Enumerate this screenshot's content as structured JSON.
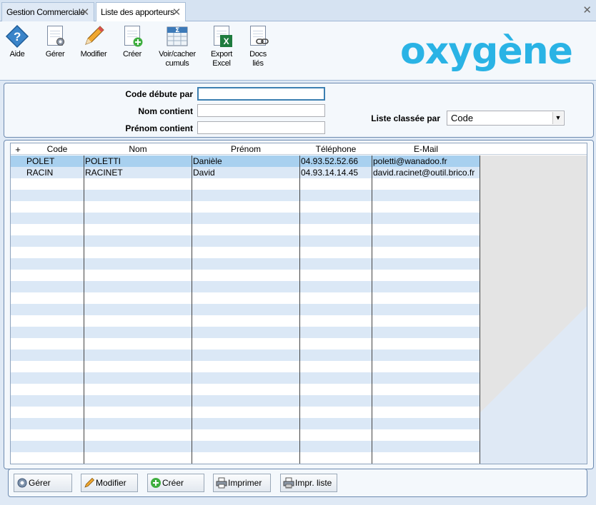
{
  "tabs": [
    {
      "label": "Gestion Commerciale",
      "active": false
    },
    {
      "label": "Liste des apporteurs",
      "active": true
    }
  ],
  "toolbar": {
    "items": [
      {
        "label": "Aide",
        "icon": "help-diamond-icon"
      },
      {
        "label": "Gérer",
        "icon": "document-gear-icon"
      },
      {
        "label": "Modifier",
        "icon": "pencil-icon"
      },
      {
        "label": "Créer",
        "icon": "document-add-icon"
      },
      {
        "label": "Voir/cacher\ncumuls",
        "icon": "sigma-icon"
      },
      {
        "label": "Export\nExcel",
        "icon": "excel-export-icon"
      },
      {
        "label": "Docs\nliés",
        "icon": "linked-docs-icon"
      }
    ],
    "logo": "oxygène"
  },
  "filter": {
    "code_label": "Code débute par",
    "code_value": "",
    "nom_label": "Nom contient",
    "nom_value": "",
    "prenom_label": "Prénom contient",
    "prenom_value": "",
    "sort_label": "Liste classée par",
    "sort_value": "Code"
  },
  "grid": {
    "columns": [
      "Code",
      "Nom",
      "Prénom",
      "Téléphone",
      "E-Mail"
    ],
    "rows": [
      {
        "code": "POLET",
        "nom": "POLETTI",
        "prenom": "Danièle",
        "telephone": "04.93.52.52.66",
        "email": "poletti@wanadoo.fr",
        "selected": true
      },
      {
        "code": "RACIN",
        "nom": "RACINET",
        "prenom": "David",
        "telephone": "04.93.14.14.45",
        "email": "david.racinet@outil.brico.fr",
        "selected": false
      }
    ]
  },
  "buttons": {
    "gerer": "Gérer",
    "modifier": "Modifier",
    "creer": "Créer",
    "imprimer": "Imprimer",
    "impr_liste": "Impr. liste"
  },
  "colors": {
    "accent": "#2ab3e5",
    "selected_row": "#a8d0ef",
    "alt_row": "#dbe8f6"
  }
}
